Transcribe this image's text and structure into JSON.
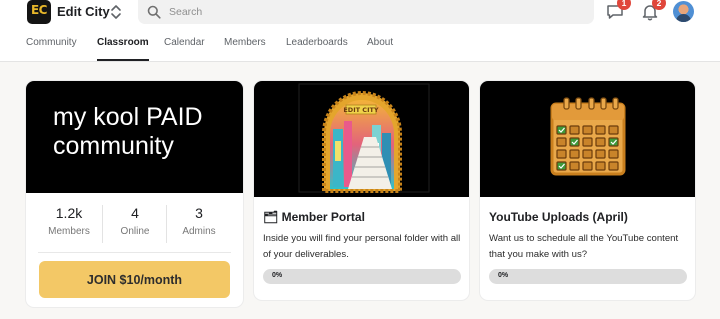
{
  "header": {
    "logo_text": "EC",
    "community_name": "Edit City",
    "search": {
      "placeholder": "Search",
      "value": ""
    },
    "chat_badge": "1",
    "notifications_badge": "2"
  },
  "nav": {
    "tabs": [
      {
        "label": "Community",
        "active": false
      },
      {
        "label": "Classroom",
        "active": true
      },
      {
        "label": "Calendar",
        "active": false
      },
      {
        "label": "Members",
        "active": false
      },
      {
        "label": "Leaderboards",
        "active": false
      },
      {
        "label": "About",
        "active": false
      }
    ]
  },
  "about_card": {
    "banner_title": "my kool PAID community",
    "stats": [
      {
        "value": "1.2k",
        "label": "Members"
      },
      {
        "value": "4",
        "label": "Online"
      },
      {
        "value": "3",
        "label": "Admins"
      }
    ],
    "join_label": "JOIN $10/month"
  },
  "courses": [
    {
      "thumb_text": "EDIT CITY",
      "title_emoji": "🗂",
      "title": "Member Portal",
      "description": "Inside you will find your personal folder with all of your deliverables.",
      "progress_label": "0%",
      "progress": 0
    },
    {
      "title": "YouTube Uploads (April)",
      "description": "Want us to schedule all the YouTube content that you make with us?",
      "progress_label": "0%",
      "progress": 0
    }
  ],
  "colors": {
    "accent_yellow": "#f3c866",
    "badge_red": "#e0463b",
    "calendar_orange": "#e29a3a",
    "calendar_green": "#3f9a3a"
  }
}
